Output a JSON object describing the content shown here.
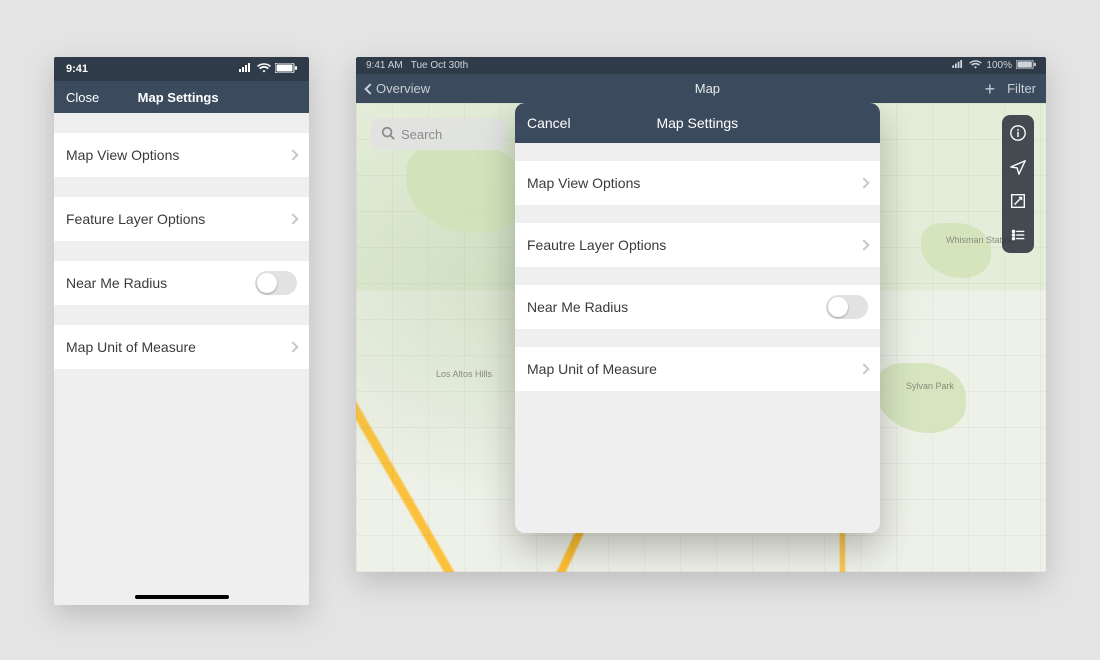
{
  "phone": {
    "status_time": "9:41",
    "close_label": "Close",
    "header_title": "Map Settings",
    "items": {
      "map_view_options": "Map View Options",
      "feature_layer_options": "Feature Layer Options",
      "near_me_radius": "Near Me Radius",
      "map_unit": "Map Unit of Measure"
    }
  },
  "tablet": {
    "status_time": "9:41 AM",
    "status_date": "Tue Oct 30th",
    "battery_pct": "100%",
    "back_label": "Overview",
    "header_title": "Map",
    "filter_label": "Filter",
    "search_placeholder": "Search",
    "map_labels": {
      "los_altos": "Los Altos Hills",
      "sylvan": "Sylvan Park",
      "whisman": "Whisman Station"
    },
    "sheet": {
      "cancel_label": "Cancel",
      "title": "Map Settings",
      "items": {
        "map_view_options": "Map View Options",
        "feature_layer_options": "Feautre Layer Options",
        "near_me_radius": "Near Me Radius",
        "map_unit": "Map Unit of Measure"
      }
    }
  }
}
